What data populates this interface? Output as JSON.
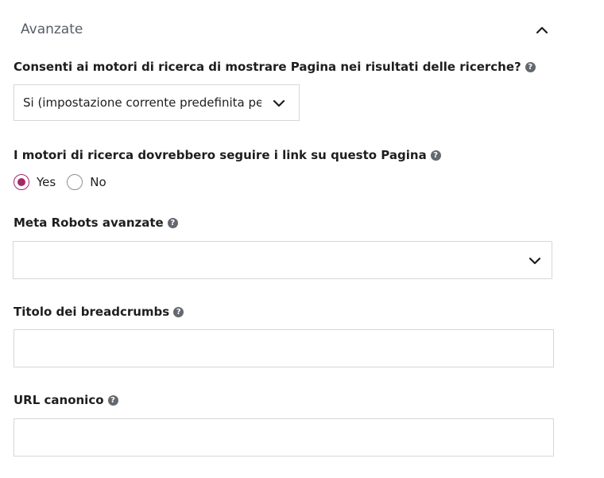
{
  "section": {
    "title": "Avanzate",
    "collapse_icon": "chevron-up-icon"
  },
  "fields": {
    "show_in_search": {
      "label": "Consenti ai motori di ricerca di mostrare Pagina nei risultati delle ricerche?",
      "help_icon": "?",
      "selected_value": "Si (impostazione corrente predefinita per"
    },
    "follow_links": {
      "label": "I motori di ricerca dovrebbero seguire i link su questo Pagina",
      "help_icon": "?",
      "options": [
        {
          "label": "Yes",
          "checked": true
        },
        {
          "label": "No",
          "checked": false
        }
      ]
    },
    "meta_robots": {
      "label": "Meta Robots avanzate",
      "help_icon": "?",
      "selected_value": ""
    },
    "breadcrumbs_title": {
      "label": "Titolo dei breadcrumbs",
      "help_icon": "?",
      "value": ""
    },
    "canonical_url": {
      "label": "URL canonico",
      "help_icon": "?",
      "value": ""
    }
  },
  "colors": {
    "accent": "#a4286a",
    "help_icon_bg": "#646970",
    "border": "#d7d7d7"
  }
}
